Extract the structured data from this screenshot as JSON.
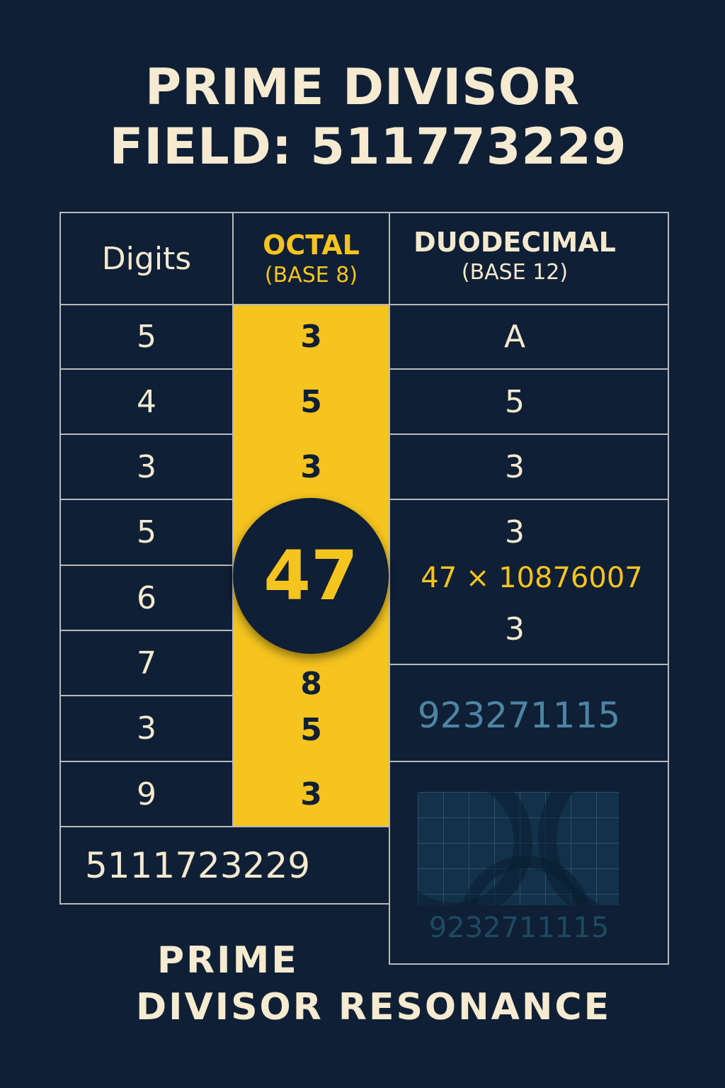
{
  "title": {
    "line1": "PRIME DIVISOR",
    "line2": "FIELD: 511773229"
  },
  "table": {
    "headers": {
      "digits": "Digits",
      "octal_line1": "OCTAL",
      "octal_line2": "(BASE 8)",
      "duodecimal_line1": "DUODECIMAL",
      "duodecimal_line2": "(BASE 12)"
    },
    "digits": [
      "5",
      "4",
      "3",
      "5",
      "6",
      "7",
      "3",
      "9"
    ],
    "octal": [
      "3",
      "5",
      "3",
      "8",
      "5",
      "3"
    ],
    "duodecimal": [
      "A",
      "5",
      "3",
      "3",
      "3"
    ],
    "highlight_factor": "47",
    "factorization": "47 × 10876007",
    "blue_number": "923271115",
    "total": "5111723229",
    "faded_number": "9232711115"
  },
  "footer": {
    "line1": "PRIME",
    "line2": "DIVISOR RESONANCE"
  },
  "colors": {
    "background": "#0f1f35",
    "accent_yellow": "#f5c41f",
    "cream": "#f4e9cf",
    "muted_blue": "#4d85a3",
    "faded_blue": "#1d4a63"
  }
}
